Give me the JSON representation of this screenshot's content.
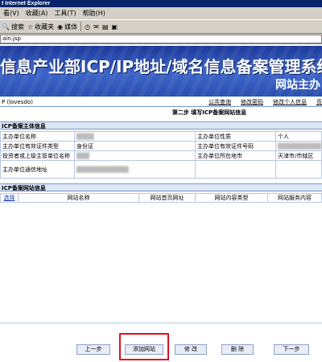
{
  "browser": {
    "title": "t Internet Explorer",
    "menu": [
      "看(V)",
      "收藏(A)",
      "工具(T)",
      "帮助(H)"
    ],
    "toolbar": [
      "搜索",
      "收藏夹",
      "媒体"
    ],
    "address": "ain.jsp"
  },
  "banner": {
    "title": "信息产业部ICP/IP地址/域名信息备案管理系统",
    "subtitle": "网站主办"
  },
  "userbar": {
    "user": "P (lovesdo)",
    "links": [
      "公共查询",
      "修改密码",
      "修改个人信息",
      "页"
    ]
  },
  "step_title": "第二步 填写ICP备案网站信息",
  "sponsor_section": {
    "heading": "ICP备案主体信息",
    "rows": [
      {
        "label1": "主办单位名称",
        "value1": "",
        "label2": "主办单位性质",
        "value2": "个人"
      },
      {
        "label1": "主办单位有效证件类型",
        "value1": "身份证",
        "label2": "主办单位有效证件号码",
        "value2": ""
      },
      {
        "label1": "投资者或上级主管单位名称",
        "value1": "",
        "label2": "主办单位所在地市",
        "value2": "天津市/市辖区"
      },
      {
        "label1": "主办单位通信地址",
        "value1": "",
        "label2": "",
        "value2": ""
      }
    ]
  },
  "site_section": {
    "heading": "ICP备案网站信息",
    "columns": [
      "选择",
      "网站名称",
      "网站首页网址",
      "网站内容类型",
      "网站服务内容"
    ]
  },
  "buttons": {
    "prev": "上一步",
    "add": "添加网站",
    "edit": "修 改",
    "delete": "删 除",
    "next": "下一步"
  },
  "colors": {
    "banner": "#2a4fb0",
    "highlight": "#e01020",
    "table_border": "#b8c8e4"
  }
}
